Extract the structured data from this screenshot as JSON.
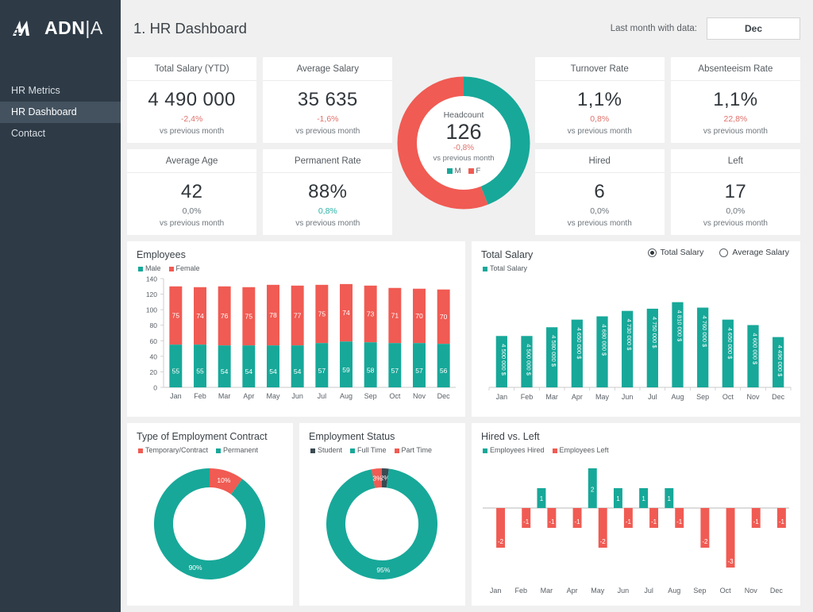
{
  "brand": {
    "name_bold": "ADN",
    "name_thin": "|A",
    "logo_icon": "adnia-m-logo-icon"
  },
  "sidebar": {
    "items": [
      {
        "label": "HR Metrics",
        "active": false
      },
      {
        "label": "HR Dashboard",
        "active": true
      },
      {
        "label": "Contact",
        "active": false
      }
    ]
  },
  "header": {
    "title": "1. HR Dashboard",
    "last_month_label": "Last month with data:",
    "last_month_value": "Dec"
  },
  "kpis": [
    {
      "title": "Total Salary (YTD)",
      "value": "4 490 000",
      "delta": "-2,4%",
      "delta_dir": "neg",
      "sub": "vs previous month"
    },
    {
      "title": "Average Salary",
      "value": "35 635",
      "delta": "-1,6%",
      "delta_dir": "neg",
      "sub": "vs previous month"
    },
    {
      "title": "Turnover Rate",
      "value": "1,1%",
      "delta": "0,8%",
      "delta_dir": "neg",
      "sub": "vs previous month"
    },
    {
      "title": "Absenteeism Rate",
      "value": "1,1%",
      "delta": "22,8%",
      "delta_dir": "neg",
      "sub": "vs previous month"
    },
    {
      "title": "Average Age",
      "value": "42",
      "delta": "0,0%",
      "delta_dir": "flat",
      "sub": "vs previous month"
    },
    {
      "title": "Permanent Rate",
      "value": "88%",
      "delta": "0,8%",
      "delta_dir": "pos",
      "sub": "vs previous month"
    },
    {
      "title": "Hired",
      "value": "6",
      "delta": "0,0%",
      "delta_dir": "flat",
      "sub": "vs previous month"
    },
    {
      "title": "Left",
      "value": "17",
      "delta": "0,0%",
      "delta_dir": "flat",
      "sub": "vs previous month"
    }
  ],
  "headcount": {
    "label": "Headcount",
    "value": "126",
    "delta": "-0,8%",
    "sub": "vs previous month",
    "legend": [
      {
        "label": "M",
        "color": "#17a899"
      },
      {
        "label": "F",
        "color": "#f05b53"
      }
    ]
  },
  "colors": {
    "teal": "#17a899",
    "red": "#f05b53",
    "dark": "#3b4a52",
    "sidebar": "#2e3b47",
    "sidebar_active": "#44525f",
    "page_bg": "#f0f0f0"
  },
  "chart_data": [
    {
      "id": "employees",
      "type": "bar",
      "title": "Employees",
      "stacked": true,
      "categories": [
        "Jan",
        "Feb",
        "Mar",
        "Apr",
        "May",
        "Jun",
        "Jul",
        "Aug",
        "Sep",
        "Oct",
        "Nov",
        "Dec"
      ],
      "series": [
        {
          "name": "Male",
          "color": "#17a899",
          "values": [
            55,
            55,
            54,
            54,
            54,
            54,
            57,
            59,
            58,
            57,
            57,
            56
          ]
        },
        {
          "name": "Female",
          "color": "#f05b53",
          "values": [
            75,
            74,
            76,
            75,
            78,
            77,
            75,
            74,
            73,
            71,
            70,
            70
          ]
        }
      ],
      "yticks": [
        0,
        20,
        40,
        60,
        80,
        100,
        120,
        140
      ],
      "ylim": [
        0,
        140
      ],
      "xlabel": "",
      "ylabel": "",
      "grid": false,
      "legend_position": "top-left"
    },
    {
      "id": "total-salary",
      "type": "bar",
      "title": "Total Salary",
      "categories": [
        "Jan",
        "Feb",
        "Mar",
        "Apr",
        "May",
        "Jun",
        "Jul",
        "Aug",
        "Sep",
        "Oct",
        "Nov",
        "Dec"
      ],
      "series": [
        {
          "name": "Total Salary",
          "color": "#17a899",
          "values": [
            4500000,
            4500000,
            4580000,
            4650000,
            4680000,
            4730000,
            4750000,
            4810000,
            4760000,
            4650000,
            4600000,
            4490000
          ],
          "labels": [
            "4 500 000 $",
            "4 500 000 $",
            "4 580 000 $",
            "4 650 000 $",
            "4 680 000 $",
            "4 730 000 $",
            "4 750 000 $",
            "4 810 000 $",
            "4 760 000 $",
            "4 650 000 $",
            "4 600 000 $",
            "4 490 000 $"
          ]
        }
      ],
      "ylim": [
        0,
        5000000
      ],
      "grid": false,
      "legend_position": "top-left",
      "toggle": {
        "options": [
          "Total Salary",
          "Average Salary"
        ],
        "selected": "Total Salary"
      }
    },
    {
      "id": "contract-type",
      "type": "pie",
      "title": "Type of Employment Contract",
      "donut": true,
      "categories": [
        "Temporary/Contract",
        "Permanent"
      ],
      "values": [
        10,
        90
      ],
      "labels": [
        "10%",
        "90%"
      ],
      "colors": [
        "#f05b53",
        "#17a899"
      ],
      "legend_position": "top-left"
    },
    {
      "id": "employment-status",
      "type": "pie",
      "title": "Employment Status",
      "donut": true,
      "categories": [
        "Student",
        "Full Time",
        "Part Time"
      ],
      "values": [
        2,
        95,
        3
      ],
      "labels": [
        "2%",
        "95%",
        "3%"
      ],
      "colors": [
        "#3b4a52",
        "#17a899",
        "#f05b53"
      ],
      "legend_position": "top-left"
    },
    {
      "id": "hired-vs-left",
      "type": "bar",
      "title": "Hired vs. Left",
      "categories": [
        "Jan",
        "Feb",
        "Mar",
        "Apr",
        "May",
        "Jun",
        "Jul",
        "Aug",
        "Sep",
        "Oct",
        "Nov",
        "Dec"
      ],
      "series": [
        {
          "name": "Employees Hired",
          "color": "#17a899",
          "values": [
            0,
            0,
            1,
            0,
            2,
            1,
            1,
            1,
            0,
            0,
            0,
            0
          ],
          "labels": [
            "",
            "",
            "1",
            "",
            "2",
            "1",
            "1",
            "1",
            "",
            "",
            "",
            ""
          ]
        },
        {
          "name": "Employees Left",
          "color": "#f05b53",
          "values": [
            -2,
            -1,
            -1,
            -1,
            -2,
            -1,
            -1,
            -1,
            -2,
            -3,
            -1,
            -1
          ],
          "labels": [
            "-2",
            "-1",
            "-1",
            "-1",
            "-2",
            "-1",
            "-1",
            "-1",
            "-2",
            "-3",
            "-1",
            "-1"
          ]
        }
      ],
      "ylim": [
        -3,
        2
      ],
      "grid": false,
      "legend_position": "top-left"
    }
  ]
}
